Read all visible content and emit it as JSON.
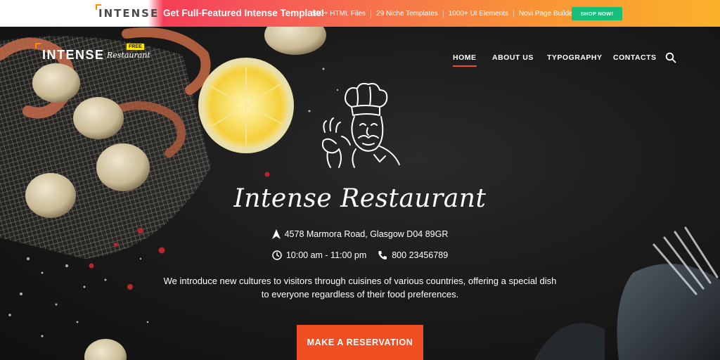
{
  "promo": {
    "logo_text": "INTENSE",
    "title": "Get Full-Featured Intense Template!",
    "features": [
      "500+ HTML Files",
      "29 Niche Templates",
      "1000+ UI Elements",
      "Novi Page Builder"
    ],
    "cta_label": "SHOP NOW!",
    "cta_color": "#17bf7a"
  },
  "site": {
    "logo_text": "INTENSE",
    "logo_sub": "Restaurant",
    "logo_badge": "FREE"
  },
  "nav": {
    "items": [
      {
        "label": "HOME",
        "active": true
      },
      {
        "label": "ABOUT US",
        "active": false
      },
      {
        "label": "TYPOGRAPHY",
        "active": false
      },
      {
        "label": "CONTACTS",
        "active": false
      }
    ],
    "search_icon": "search-icon",
    "accent_color": "#f04e23"
  },
  "hero": {
    "title": "Intense Restaurant",
    "address": "4578 Marmora Road, Glasgow D04 89GR",
    "hours": "10:00 am - 11:00 pm",
    "phone": "800 23456789",
    "description": "We introduce new cultures to visitors through cuisines of various countries, offering a special dish to everyone regardless of their food preferences.",
    "cta_label": "MAKE A RESERVATION",
    "icons": [
      "chef-illustration",
      "location-arrow-icon",
      "clock-icon",
      "phone-icon"
    ]
  }
}
